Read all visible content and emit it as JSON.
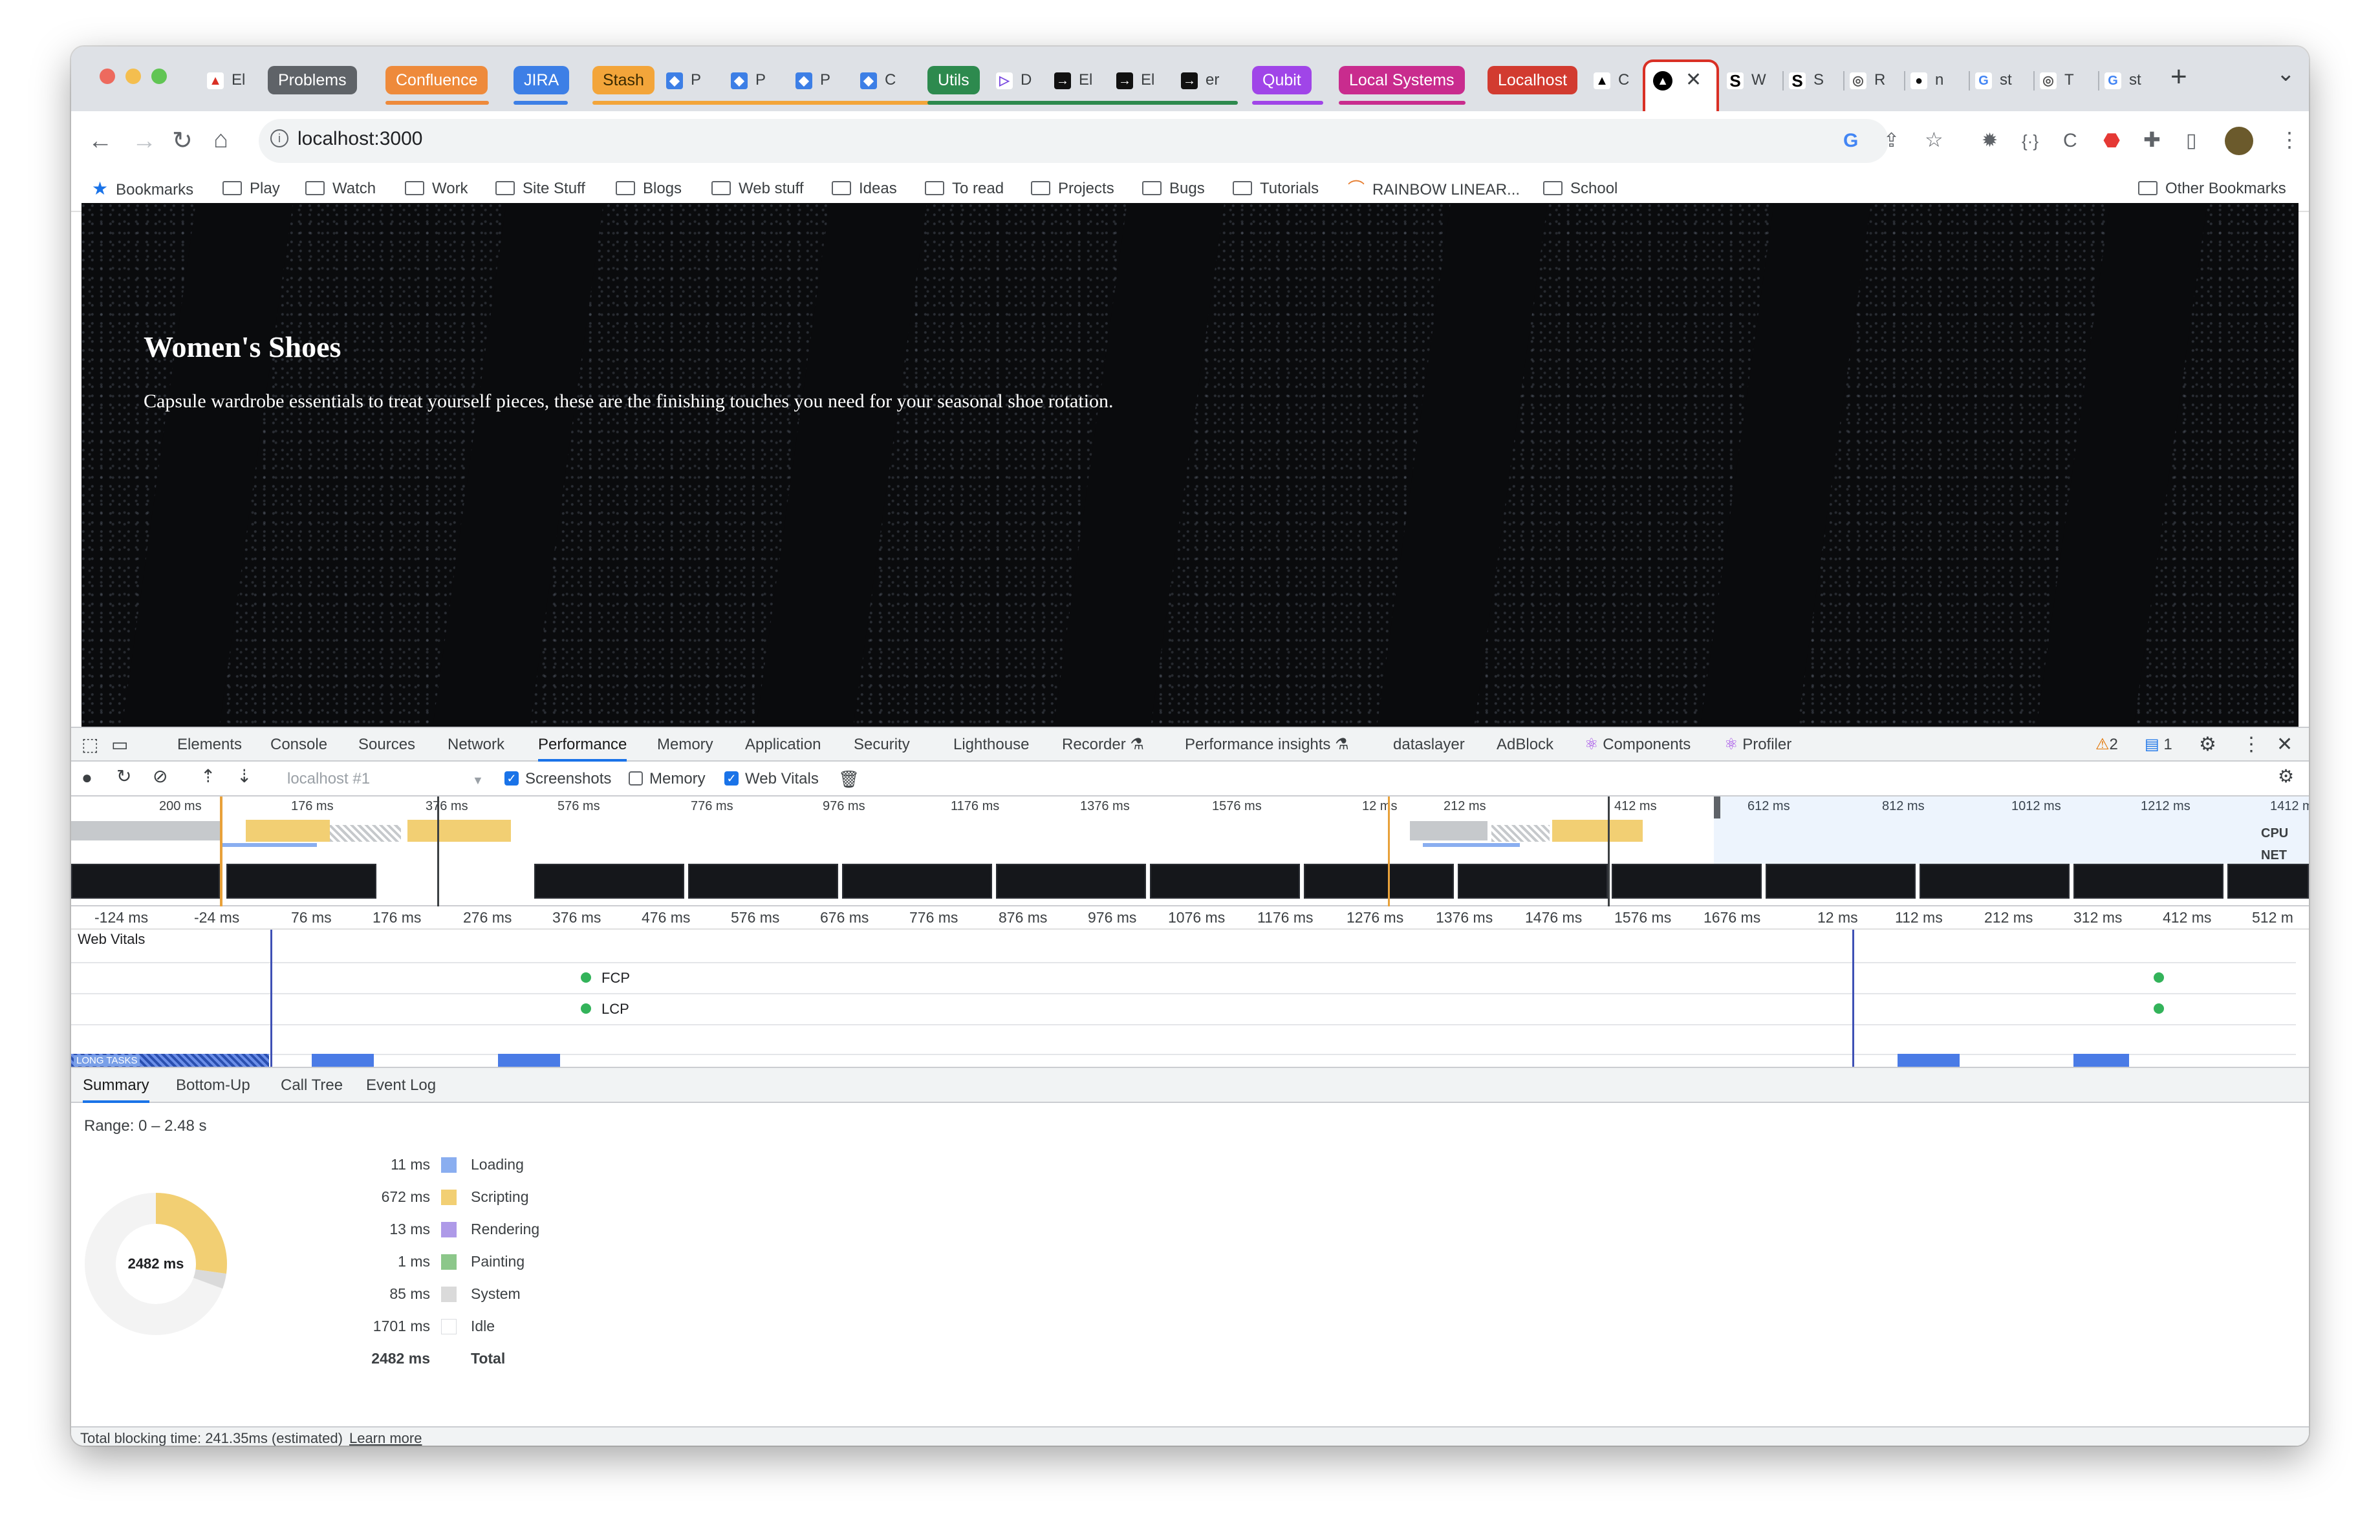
{
  "tabs": {
    "groups": [
      {
        "label": "Problems",
        "color": "#5f6368"
      },
      {
        "label": "Confluence",
        "color": "#ee8a3b"
      },
      {
        "label": "JIRA",
        "color": "#3d7fe6"
      },
      {
        "label": "Stash",
        "color": "#f3a53a"
      },
      {
        "label": "Utils",
        "color": "#2d8a4e"
      },
      {
        "label": "Qubit",
        "color": "#a045e8"
      },
      {
        "label": "Local Systems",
        "color": "#c92c8e"
      },
      {
        "label": "Localhost",
        "color": "#d23b30"
      }
    ],
    "tiny": [
      "El",
      "P",
      "P",
      "P",
      "C",
      "D",
      "El",
      "El",
      "er",
      "C",
      "W",
      "S",
      "R",
      "n",
      "st",
      "T",
      "st"
    ],
    "new_tab_glyph": "+",
    "dropdown_glyph": "⌄"
  },
  "toolbar": {
    "url": "localhost:3000"
  },
  "bookmarks": {
    "items": [
      "Bookmarks",
      "Play",
      "Watch",
      "Work",
      "Site Stuff",
      "Blogs",
      "Web stuff",
      "Ideas",
      "To read",
      "Projects",
      "Bugs",
      "Tutorials",
      "RAINBOW LINEAR...",
      "School"
    ],
    "other": "Other Bookmarks"
  },
  "page": {
    "title": "Women's Shoes",
    "subtitle": "Capsule wardrobe essentials to treat yourself pieces, these are the finishing touches you need for your seasonal shoe rotation."
  },
  "devtools": {
    "tabs": [
      "Elements",
      "Console",
      "Sources",
      "Network",
      "Performance",
      "Memory",
      "Application",
      "Security",
      "Lighthouse",
      "Recorder ⚗",
      "Performance insights ⚗",
      "dataslayer",
      "AdBlock",
      "Components",
      "Profiler"
    ],
    "active_tab": "Performance",
    "warnings": "2",
    "messages": "1",
    "perf": {
      "profile_select": "localhost #1",
      "screenshots_label": "Screenshots",
      "memory_label": "Memory",
      "webvitals_label": "Web Vitals",
      "cpu_label": "CPU",
      "net_label": "NET",
      "overview_ticks": [
        "200 ms",
        "176 ms",
        "376 ms",
        "576 ms",
        "776 ms",
        "976 ms",
        "1176 ms",
        "1376 ms",
        "1576 ms",
        "12 ms",
        "212 ms",
        "412 ms",
        "612 ms",
        "812 ms",
        "1012 ms",
        "1212 ms",
        "1412 m"
      ],
      "ruler_ticks": [
        "-124 ms",
        "-24 ms",
        "76 ms",
        "176 ms",
        "276 ms",
        "376 ms",
        "476 ms",
        "576 ms",
        "676 ms",
        "776 ms",
        "876 ms",
        "976 ms",
        "1076 ms",
        "1176 ms",
        "1276 ms",
        "1376 ms",
        "1476 ms",
        "1576 ms",
        "1676 ms",
        "12 ms",
        "112 ms",
        "212 ms",
        "312 ms",
        "412 ms",
        "512 m"
      ],
      "web_vitals_label": "Web Vitals",
      "fcp": "FCP",
      "lcp": "LCP",
      "long_tasks": "LONG TASKS"
    },
    "subtabs": [
      "Summary",
      "Bottom-Up",
      "Call Tree",
      "Event Log"
    ],
    "summary": {
      "range": "Range: 0 – 2.48 s",
      "donut_center": "2482 ms",
      "rows": [
        {
          "value": "11 ms",
          "label": "Loading",
          "color": "#8aaef0"
        },
        {
          "value": "672 ms",
          "label": "Scripting",
          "color": "#f2cf73"
        },
        {
          "value": "13 ms",
          "label": "Rendering",
          "color": "#ae9ae8"
        },
        {
          "value": "1 ms",
          "label": "Painting",
          "color": "#8cc78a"
        },
        {
          "value": "85 ms",
          "label": "System",
          "color": "#dadada"
        },
        {
          "value": "1701 ms",
          "label": "Idle",
          "color": "#ffffff"
        },
        {
          "value": "2482 ms",
          "label": "Total",
          "color": ""
        }
      ]
    },
    "status": {
      "text": "Total blocking time: 241.35ms (estimated)",
      "link": "Learn more"
    }
  }
}
